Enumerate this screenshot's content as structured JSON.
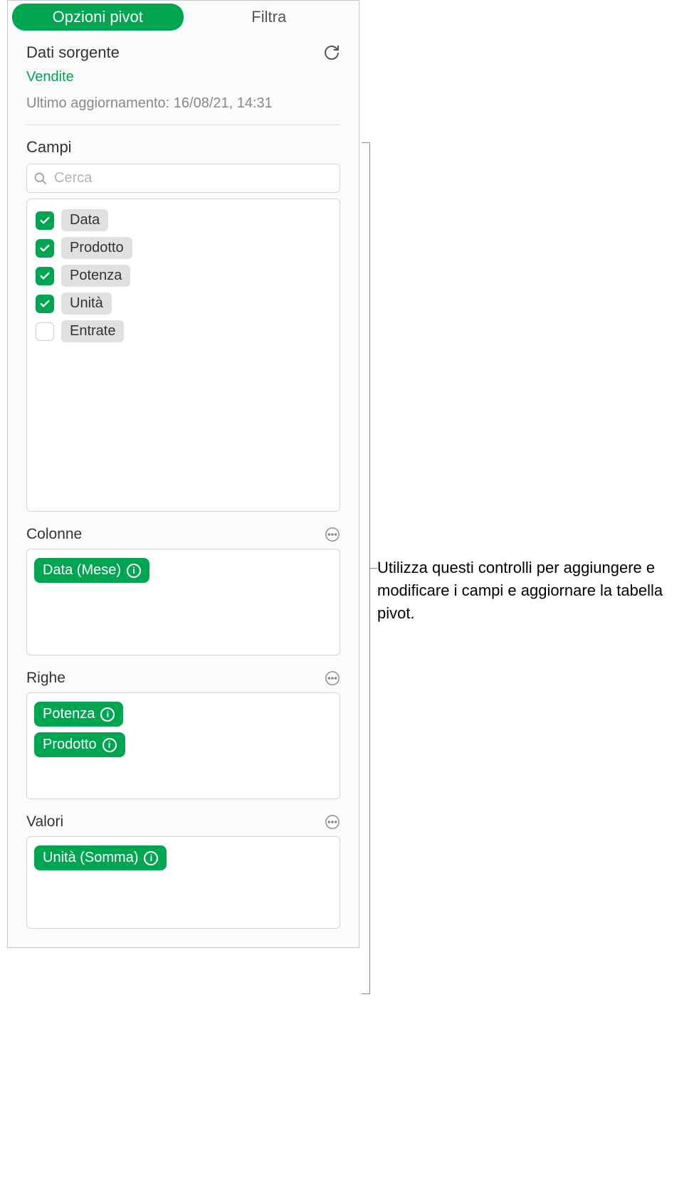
{
  "tabs": {
    "pivot": "Opzioni pivot",
    "filter": "Filtra"
  },
  "source": {
    "label": "Dati sorgente",
    "name": "Vendite",
    "updated": "Ultimo aggiornamento: 16/08/21, 14:31"
  },
  "fields": {
    "label": "Campi",
    "search_placeholder": "Cerca",
    "items": [
      {
        "label": "Data",
        "checked": true
      },
      {
        "label": "Prodotto",
        "checked": true
      },
      {
        "label": "Potenza",
        "checked": true
      },
      {
        "label": "Unità",
        "checked": true
      },
      {
        "label": "Entrate",
        "checked": false
      }
    ]
  },
  "zones": {
    "columns": {
      "title": "Colonne",
      "items": [
        {
          "label": "Data (Mese)"
        }
      ]
    },
    "rows": {
      "title": "Righe",
      "items": [
        {
          "label": "Potenza"
        },
        {
          "label": "Prodotto"
        }
      ]
    },
    "values": {
      "title": "Valori",
      "items": [
        {
          "label": "Unità (Somma)"
        }
      ]
    }
  },
  "callout": "Utilizza questi controlli per aggiungere e modificare i campi e aggiornare la tabella pivot."
}
